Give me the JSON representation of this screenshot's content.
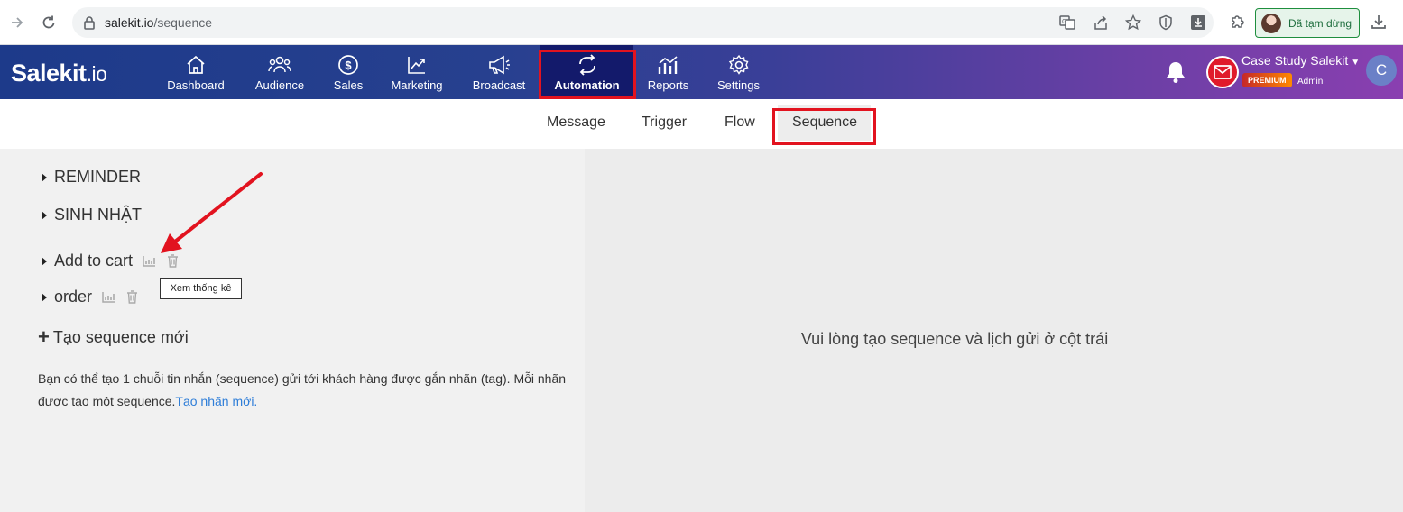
{
  "browser": {
    "url_host": "salekit.io",
    "url_path": "/sequence",
    "profile_label": "Đã tạm dừng"
  },
  "header": {
    "logo_main": "Salekit",
    "logo_suffix": ".io",
    "menu": [
      {
        "label": "Dashboard",
        "icon": "home-icon"
      },
      {
        "label": "Audience",
        "icon": "users-icon"
      },
      {
        "label": "Sales",
        "icon": "dollar-icon"
      },
      {
        "label": "Marketing",
        "icon": "chart-up-icon"
      },
      {
        "label": "Broadcast",
        "icon": "megaphone-icon"
      },
      {
        "label": "Automation",
        "icon": "repeat-icon",
        "active": true
      },
      {
        "label": "Reports",
        "icon": "reports-icon"
      },
      {
        "label": "Settings",
        "icon": "gear-icon"
      }
    ],
    "account_name": "Case Study Salekit",
    "badge": "PREMIUM",
    "role": "Admin",
    "avatar_letter": "C"
  },
  "subtabs": [
    {
      "label": "Message"
    },
    {
      "label": "Trigger"
    },
    {
      "label": "Flow"
    },
    {
      "label": "Sequence",
      "active": true
    }
  ],
  "sequences": [
    {
      "label": "REMINDER"
    },
    {
      "label": "SINH NHẬT"
    },
    {
      "label": "Add to cart"
    },
    {
      "label": "order"
    }
  ],
  "tooltip": "Xem thống kê",
  "new_sequence_label": "Tạo sequence mới",
  "description": "Bạn có thể tạo 1 chuỗi tin nhắn (sequence) gửi tới khách hàng được gắn nhãn (tag). Mỗi nhãn được tạo một sequence.",
  "description_link": "Tạo nhãn mới.",
  "empty_message": "Vui lòng tạo sequence và lịch gửi ở cột trái",
  "colors": {
    "highlight_box": "#e2131f",
    "link": "#2f7ed8",
    "active_menu": "#131a6b"
  }
}
